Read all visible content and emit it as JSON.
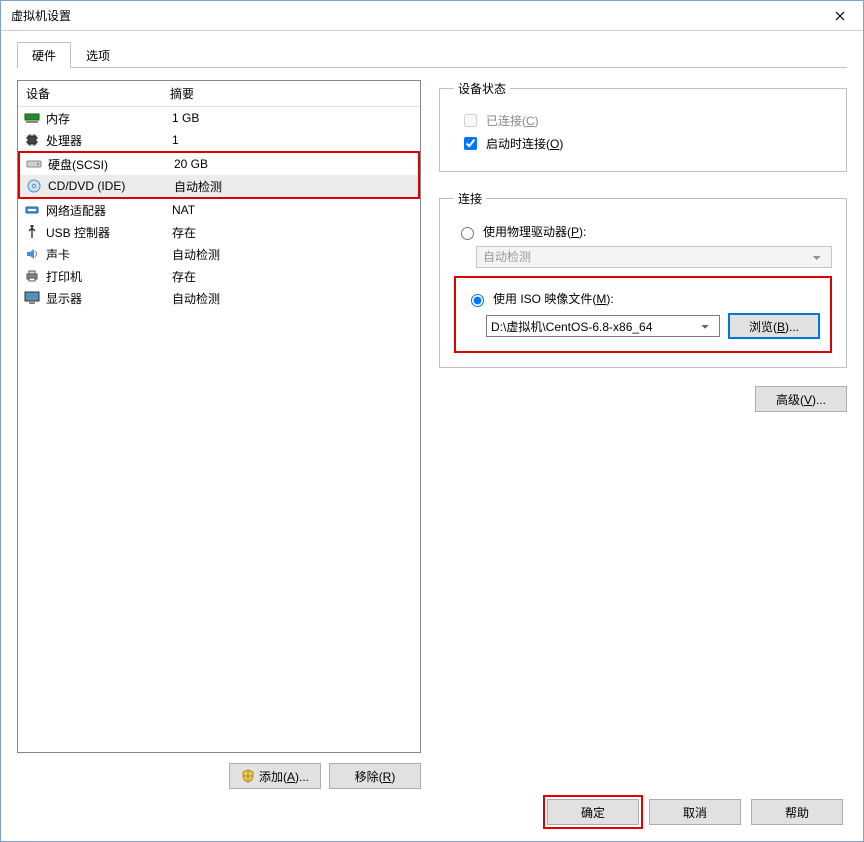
{
  "window": {
    "title": "虚拟机设置"
  },
  "tabs": {
    "hardware": "硬件",
    "options": "选项"
  },
  "list": {
    "header_name": "设备",
    "header_summary": "摘要",
    "rows": [
      {
        "name": "内存",
        "summary": "1 GB"
      },
      {
        "name": "处理器",
        "summary": "1"
      },
      {
        "name": "硬盘(SCSI)",
        "summary": "20 GB"
      },
      {
        "name": "CD/DVD (IDE)",
        "summary": "自动检测"
      },
      {
        "name": "网络适配器",
        "summary": "NAT"
      },
      {
        "name": "USB 控制器",
        "summary": "存在"
      },
      {
        "name": "声卡",
        "summary": "自动检测"
      },
      {
        "name": "打印机",
        "summary": "存在"
      },
      {
        "name": "显示器",
        "summary": "自动检测"
      }
    ]
  },
  "left_buttons": {
    "add": "添加(A)...",
    "remove": "移除(R)"
  },
  "status": {
    "legend": "设备状态",
    "connected": "已连接(C)",
    "connect_on_power": "启动时连接(O)"
  },
  "connection": {
    "legend": "连接",
    "use_physical": "使用物理驱动器(P):",
    "physical_value": "自动检测",
    "use_iso": "使用 ISO 映像文件(M):",
    "iso_path": "D:\\虚拟机\\CentOS-6.8-x86_64",
    "browse": "浏览(B)..."
  },
  "advanced": "高级(V)...",
  "footer": {
    "ok": "确定",
    "cancel": "取消",
    "help": "帮助"
  }
}
